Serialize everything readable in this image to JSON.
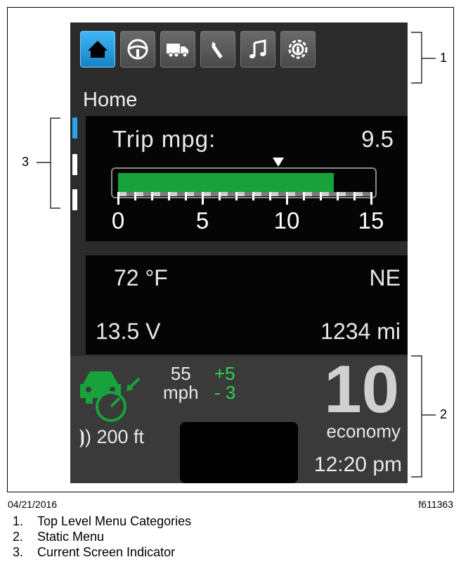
{
  "screen": {
    "title": "Home",
    "tabs": [
      {
        "icon": "home-icon",
        "active": true
      },
      {
        "icon": "steering-wheel-icon",
        "active": false
      },
      {
        "icon": "truck-icon",
        "active": false
      },
      {
        "icon": "wrench-icon",
        "active": false
      },
      {
        "icon": "music-note-icon",
        "active": false
      },
      {
        "icon": "settings-gear-icon",
        "active": false
      }
    ],
    "trip": {
      "label": "Trip mpg:",
      "value": "9.5",
      "gauge_fill_value": 12.8,
      "gauge_marker_value": 9.5,
      "gauge_max": 15,
      "ticks": [
        "0",
        "5",
        "10",
        "15"
      ]
    },
    "info": {
      "temperature": "72 °F",
      "heading": "NE",
      "voltage": "13.5  V",
      "odometer": "1234 mi"
    },
    "static_menu": {
      "set_speed": "55",
      "speed_unit": "mph",
      "offset_plus": "+5",
      "offset_minus": "- 3",
      "distance": "200 ft",
      "big_number": "10",
      "economy_label": "economy",
      "time": "12:20 pm"
    },
    "colors": {
      "active_tab": "#2aa3ee",
      "gauge_green": "#17a23b",
      "accent_green": "#2bd44e"
    }
  },
  "callouts": {
    "one": "1",
    "two": "2",
    "three": "3"
  },
  "footer": {
    "date": "04/21/2016",
    "code": "f611363"
  },
  "legend": [
    {
      "num": "1.",
      "text": "Top Level Menu Categories"
    },
    {
      "num": "2.",
      "text": "Static Menu"
    },
    {
      "num": "3.",
      "text": "Current Screen Indicator"
    }
  ]
}
